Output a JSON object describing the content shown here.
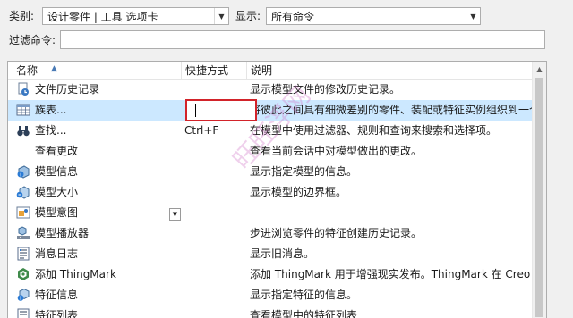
{
  "category": {
    "label": "类别:",
    "value": "设计零件 | 工具 选项卡"
  },
  "show": {
    "label": "显示:",
    "value": "所有命令"
  },
  "filter": {
    "label": "过滤命令:",
    "value": ""
  },
  "table": {
    "columns": {
      "name": "名称",
      "shortcut": "快捷方式",
      "description": "说明"
    },
    "rows": [
      {
        "icon": "file-history-icon",
        "name": "文件历史记录",
        "shortcut": "",
        "description": "显示模型文件的修改历史记录。"
      },
      {
        "icon": "family-table-icon",
        "name": "族表...",
        "shortcut": "",
        "description": "将彼此之间具有细微差别的零件、装配或特征实例组织到一个",
        "selected": true
      },
      {
        "icon": "binoculars-icon",
        "name": "查找...",
        "shortcut": "Ctrl+F",
        "description": "在模型中使用过滤器、规则和查询来搜索和选择项。"
      },
      {
        "icon": "",
        "name": "查看更改",
        "shortcut": "",
        "description": "查看当前会话中对模型做出的更改。"
      },
      {
        "icon": "model-info-icon",
        "name": "模型信息",
        "shortcut": "",
        "description": "显示指定模型的信息。"
      },
      {
        "icon": "model-size-icon",
        "name": "模型大小",
        "shortcut": "",
        "description": "显示模型的边界框。"
      },
      {
        "icon": "model-intent-icon",
        "name": "模型意图",
        "shortcut": "",
        "description": ""
      },
      {
        "icon": "model-player-icon",
        "name": "模型播放器",
        "shortcut": "",
        "description": "步进浏览零件的特征创建历史记录。"
      },
      {
        "icon": "message-log-icon",
        "name": "消息日志",
        "shortcut": "",
        "description": "显示旧消息。"
      },
      {
        "icon": "thingmark-icon",
        "name": "添加 ThingMark",
        "shortcut": "",
        "description": "添加 ThingMark 用于增强现实发布。ThingMark 在 Creo 中"
      },
      {
        "icon": "feature-info-icon",
        "name": "特征信息",
        "shortcut": "",
        "description": "显示指定特征的信息。"
      },
      {
        "icon": "feature-list-icon",
        "name": "特征列表",
        "shortcut": "",
        "description": "查看模型中的特征列表"
      }
    ]
  },
  "watermark": "旺旺浮网"
}
